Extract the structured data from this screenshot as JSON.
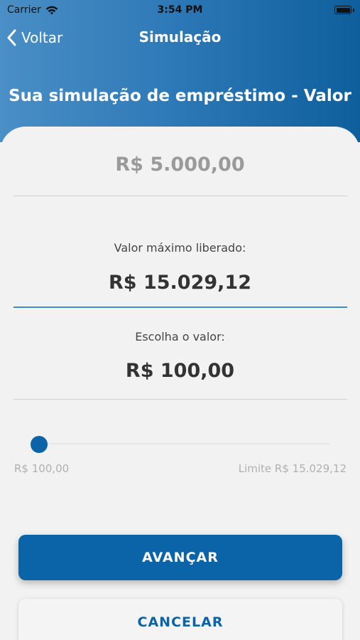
{
  "status_bar": {
    "carrier": "Carrier",
    "time": "3:54 PM",
    "icons": [
      "wifi-icon",
      "battery-icon"
    ]
  },
  "nav": {
    "back_label": "Voltar",
    "title": "Simulação",
    "back_icon": "chevron-left-icon"
  },
  "page": {
    "heading": "Sua simulação de empréstimo - Valor"
  },
  "loan": {
    "amount": "R$ 5.000,00"
  },
  "max_release": {
    "label": "Valor máximo liberado:",
    "value": "R$ 15.029,12"
  },
  "choose": {
    "label": "Escolha o valor:",
    "value": "R$ 100,00"
  },
  "slider": {
    "min_label": "R$ 100,00",
    "max_label": "Limite R$ 15.029,12",
    "min_value": 100.0,
    "max_value": 15029.12,
    "current_value": 100.0
  },
  "buttons": {
    "next_label": "AVANÇAR",
    "cancel_label": "CANCELAR"
  },
  "colors": {
    "primary": "#0b63a8",
    "header_gradient_start": "#4a8fc6",
    "header_gradient_end": "#0e5f9c",
    "background": "#f2f2f2"
  }
}
